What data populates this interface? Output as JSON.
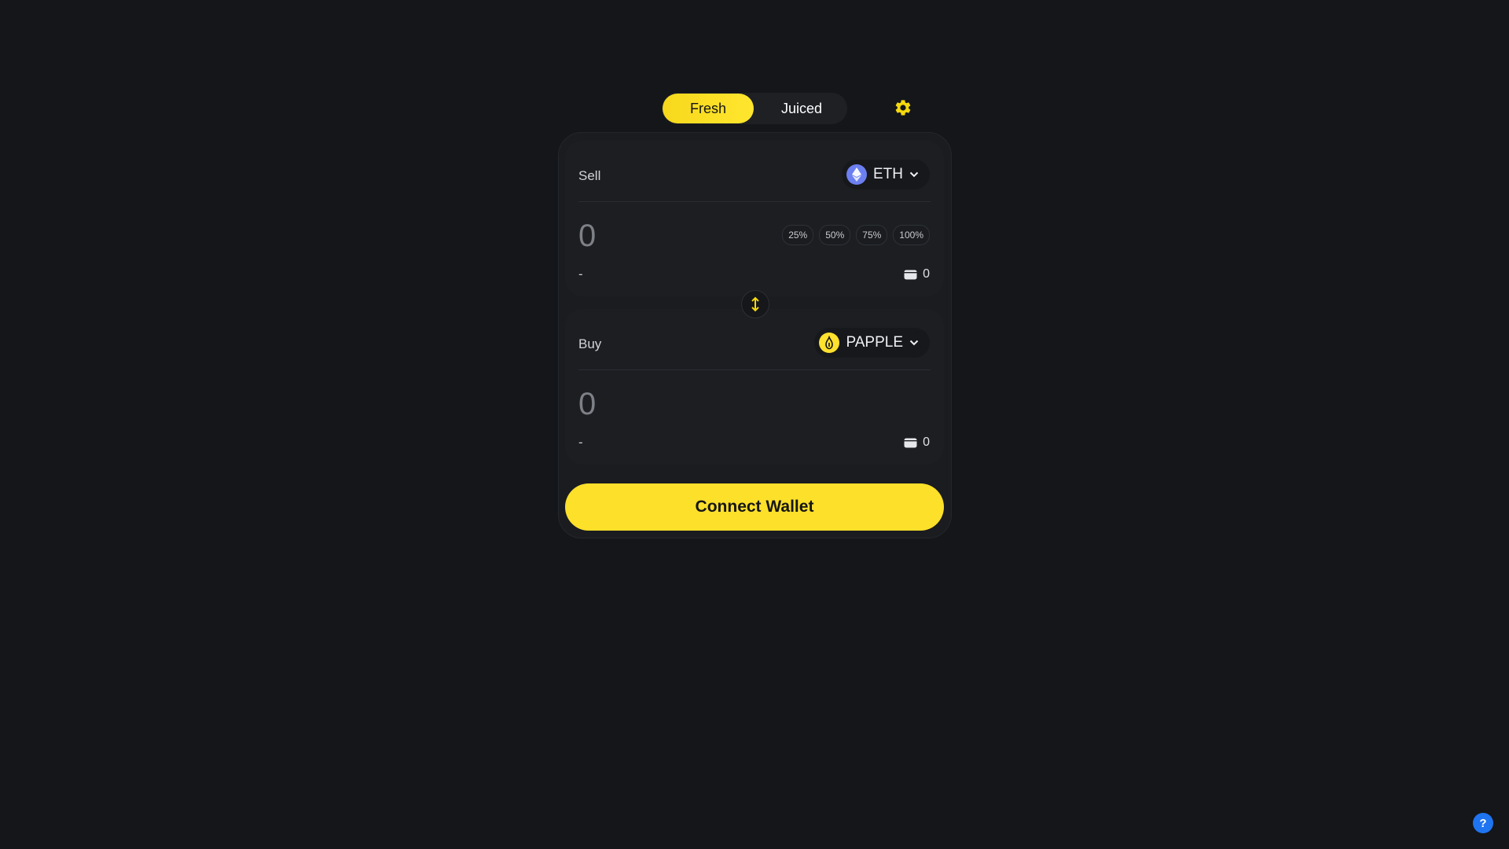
{
  "mode_toggle": {
    "fresh_label": "Fresh",
    "juiced_label": "Juiced",
    "active": "Fresh"
  },
  "settings": {
    "icon": "gear-icon"
  },
  "sell": {
    "label": "Sell",
    "token": {
      "symbol": "ETH",
      "icon": "ethereum-icon"
    },
    "amount_placeholder": "0",
    "percent_buttons": [
      "25%",
      "50%",
      "75%",
      "100%"
    ],
    "usd_value": "-",
    "balance": "0"
  },
  "swap": {
    "icon": "swap-arrows-icon"
  },
  "buy": {
    "label": "Buy",
    "token": {
      "symbol": "PAPPLE",
      "icon": "papple-token-icon"
    },
    "amount_placeholder": "0",
    "usd_value": "-",
    "balance": "0"
  },
  "connect_wallet": {
    "label": "Connect Wallet"
  },
  "help": {
    "label": "?"
  },
  "colors": {
    "background": "#141619",
    "accent": "#fde02a",
    "card": "#1a1c20",
    "panel": "#1c1e22",
    "eth": "#6c7ff0",
    "help": "#1f74f0"
  }
}
